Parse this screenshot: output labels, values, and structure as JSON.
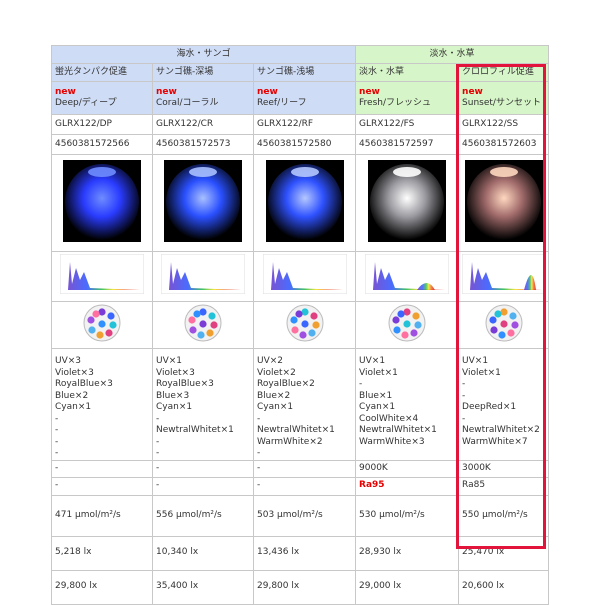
{
  "groups": {
    "marine": "海水・サンゴ",
    "fresh": "淡水・水草"
  },
  "products": [
    {
      "category": "蛍光タンパク促進",
      "new_label": "new",
      "name": "Deep/ディープ",
      "model": "GLRX122/DP",
      "jan": "4560381572566",
      "leds": [
        "UV×3",
        "Violet×3",
        "RoyalBlue×3",
        "Blue×2",
        "Cyan×1",
        "-",
        "-",
        "-",
        "-"
      ],
      "cct": "-",
      "ra": "-",
      "ppfd": "471 μmol/m²/s",
      "lux1": "5,218 lx",
      "lux2": "29,800 lx",
      "glow_color": "#2a3cff",
      "glow_core": "#6f8dff"
    },
    {
      "category": "サンゴ礁-深場",
      "new_label": "new",
      "name": "Coral/コーラル",
      "model": "GLRX122/CR",
      "jan": "4560381572573",
      "leds": [
        "UV×1",
        "Violet×3",
        "RoyalBlue×3",
        "Blue×3",
        "Cyan×1",
        "-",
        "NewtralWhitet×1",
        "-",
        "-"
      ],
      "cct": "-",
      "ra": "-",
      "ppfd": "556 μmol/m²/s",
      "lux1": "10,340 lx",
      "lux2": "35,400 lx",
      "glow_color": "#2a50ff",
      "glow_core": "#a9c0ff"
    },
    {
      "category": "サンゴ礁-浅場",
      "new_label": "new",
      "name": "Reef/リーフ",
      "model": "GLRX122/RF",
      "jan": "4560381572580",
      "leds": [
        "UV×2",
        "Violet×2",
        "RoyalBlue×2",
        "Blue×2",
        "Cyan×1",
        "-",
        "NewtralWhitet×1",
        "WarmWhite×2",
        "-"
      ],
      "cct": "-",
      "ra": "-",
      "ppfd": "503 μmol/m²/s",
      "lux1": "13,436 lx",
      "lux2": "29,800 lx",
      "glow_color": "#2f52ff",
      "glow_core": "#b5c8ff"
    },
    {
      "category": "淡水・水草",
      "new_label": "new",
      "name": "Fresh/フレッシュ",
      "model": "GLRX122/FS",
      "jan": "4560381572597",
      "leds": [
        "UV×1",
        "Violet×1",
        "-",
        "Blue×1",
        "Cyan×1",
        "CoolWhite×4",
        "NewtralWhitet×1",
        "WarmWhite×3",
        ""
      ],
      "cct": "9000K",
      "ra": "Ra95",
      "ppfd": "530 μmol/m²/s",
      "lux1": "28,930 lx",
      "lux2": "29,000 lx",
      "glow_color": "#9a9aa0",
      "glow_core": "#ffffff"
    },
    {
      "category": "クロロフィル促進",
      "new_label": "new",
      "name": "Sunset/サンセット",
      "model": "GLRX122/SS",
      "jan": "4560381572603",
      "leds": [
        "UV×1",
        "Violet×1",
        "-",
        "-",
        "DeepRed×1",
        "-",
        "NewtralWhitet×2",
        "WarmWhite×7",
        ""
      ],
      "cct": "3000K",
      "ra": "Ra85",
      "ppfd": "550 μmol/m²/s",
      "lux1": "25,470 lx",
      "lux2": "20,600 lx",
      "glow_color": "#a06a6a",
      "glow_core": "#ffd8c0"
    }
  ]
}
